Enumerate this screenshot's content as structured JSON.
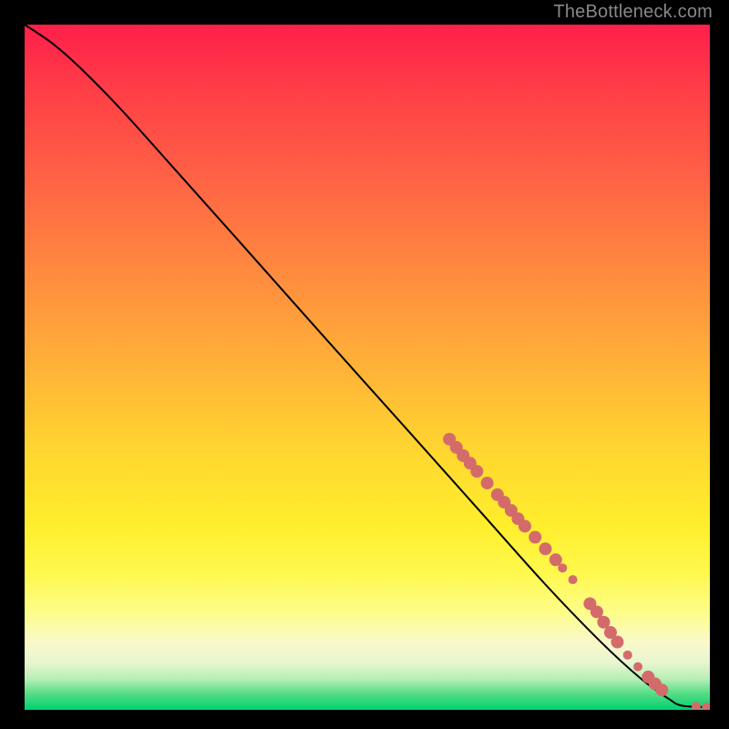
{
  "attribution": "TheBottleneck.com",
  "chart_data": {
    "type": "line",
    "title": "",
    "xlabel": "",
    "ylabel": "",
    "xlim": [
      0,
      100
    ],
    "ylim": [
      0,
      100
    ],
    "curve": {
      "description": "Monotonically decreasing curve from top-left to bottom-right; slight concave bend near the top, near-linear through the middle, flattening at the very end.",
      "points": [
        {
          "x": 0.0,
          "y": 100.0
        },
        {
          "x": 4.0,
          "y": 97.3
        },
        {
          "x": 8.0,
          "y": 93.8
        },
        {
          "x": 14.0,
          "y": 87.7
        },
        {
          "x": 22.0,
          "y": 78.8
        },
        {
          "x": 32.0,
          "y": 67.6
        },
        {
          "x": 44.0,
          "y": 54.1
        },
        {
          "x": 56.0,
          "y": 40.7
        },
        {
          "x": 66.0,
          "y": 29.5
        },
        {
          "x": 76.0,
          "y": 18.3
        },
        {
          "x": 84.0,
          "y": 10.0
        },
        {
          "x": 90.0,
          "y": 4.5
        },
        {
          "x": 94.0,
          "y": 1.6
        },
        {
          "x": 96.0,
          "y": 0.6
        },
        {
          "x": 100.0,
          "y": 0.4
        }
      ]
    },
    "markers": {
      "color": "#d46b6b",
      "radius_small": 5,
      "radius_large": 7,
      "points": [
        {
          "x": 62.0,
          "y": 39.5,
          "r": 7
        },
        {
          "x": 63.0,
          "y": 38.3,
          "r": 7
        },
        {
          "x": 64.0,
          "y": 37.1,
          "r": 7
        },
        {
          "x": 65.0,
          "y": 36.0,
          "r": 7
        },
        {
          "x": 66.0,
          "y": 34.8,
          "r": 7
        },
        {
          "x": 67.5,
          "y": 33.1,
          "r": 7
        },
        {
          "x": 69.0,
          "y": 31.4,
          "r": 7
        },
        {
          "x": 70.0,
          "y": 30.3,
          "r": 7
        },
        {
          "x": 71.0,
          "y": 29.1,
          "r": 7
        },
        {
          "x": 72.0,
          "y": 27.9,
          "r": 7
        },
        {
          "x": 73.0,
          "y": 26.8,
          "r": 7
        },
        {
          "x": 74.5,
          "y": 25.2,
          "r": 7
        },
        {
          "x": 76.0,
          "y": 23.5,
          "r": 7
        },
        {
          "x": 77.5,
          "y": 21.9,
          "r": 7
        },
        {
          "x": 78.5,
          "y": 20.7,
          "r": 5
        },
        {
          "x": 80.0,
          "y": 19.0,
          "r": 5
        },
        {
          "x": 82.5,
          "y": 15.5,
          "r": 7
        },
        {
          "x": 83.5,
          "y": 14.3,
          "r": 7
        },
        {
          "x": 84.5,
          "y": 12.8,
          "r": 7
        },
        {
          "x": 85.5,
          "y": 11.3,
          "r": 7
        },
        {
          "x": 86.5,
          "y": 9.9,
          "r": 7
        },
        {
          "x": 88.0,
          "y": 8.0,
          "r": 5
        },
        {
          "x": 89.5,
          "y": 6.3,
          "r": 5
        },
        {
          "x": 91.0,
          "y": 4.8,
          "r": 7
        },
        {
          "x": 92.0,
          "y": 3.8,
          "r": 7
        },
        {
          "x": 93.0,
          "y": 2.9,
          "r": 7
        },
        {
          "x": 98.0,
          "y": 0.5,
          "r": 5
        },
        {
          "x": 99.5,
          "y": 0.4,
          "r": 5
        }
      ]
    },
    "gradient_stops": [
      {
        "pos": 0.0,
        "color": "#ff1f4a"
      },
      {
        "pos": 0.22,
        "color": "#ff6145"
      },
      {
        "pos": 0.5,
        "color": "#ffb238"
      },
      {
        "pos": 0.73,
        "color": "#ffee2c"
      },
      {
        "pos": 0.9,
        "color": "#faf9c9"
      },
      {
        "pos": 1.0,
        "color": "#00d172"
      }
    ]
  }
}
